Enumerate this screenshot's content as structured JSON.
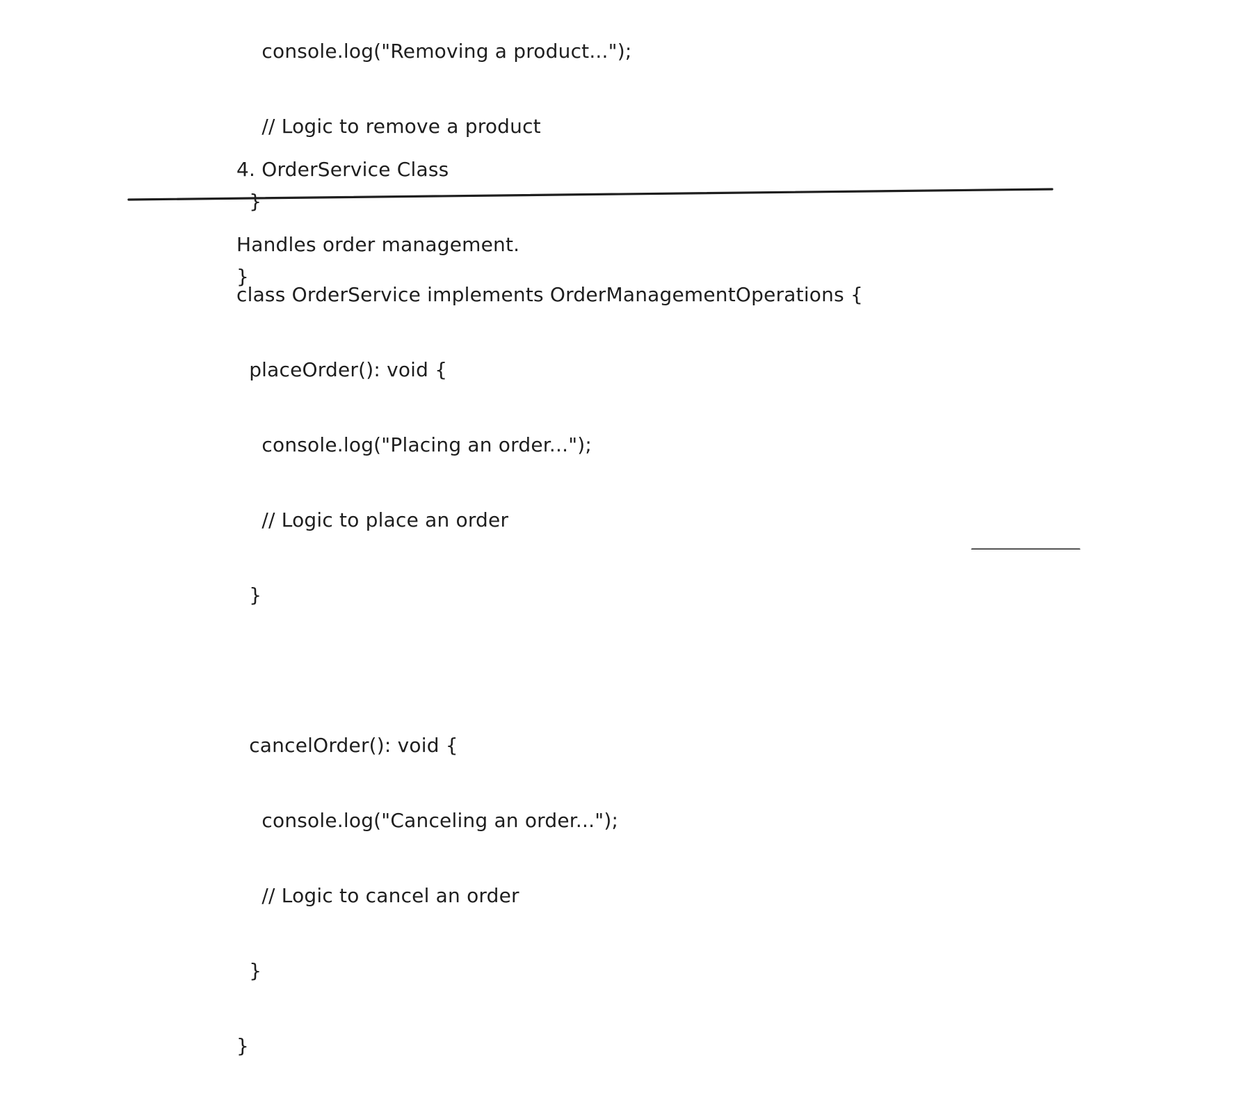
{
  "canvas": {
    "top_block": {
      "line1": "    console.log(\"Removing a product...\");",
      "line2": "    // Logic to remove a product",
      "line3": "  }",
      "line4": "}"
    },
    "section": {
      "title": "4. OrderService Class",
      "description": "Handles order management."
    },
    "code": {
      "line1": "class OrderService implements OrderManagementOperations {",
      "line2": "  placeOrder(): void {",
      "line3": "    console.log(\"Placing an order...\");",
      "line4": "    // Logic to place an order",
      "line5": "  }",
      "line6": "",
      "line7": "  cancelOrder(): void {",
      "line8": "    console.log(\"Canceling an order...\");",
      "line9": "    // Logic to cancel an order",
      "line10": "  }",
      "line11": "}"
    },
    "colors": {
      "background": "#ffffff",
      "ink": "#1e1e1e"
    }
  }
}
